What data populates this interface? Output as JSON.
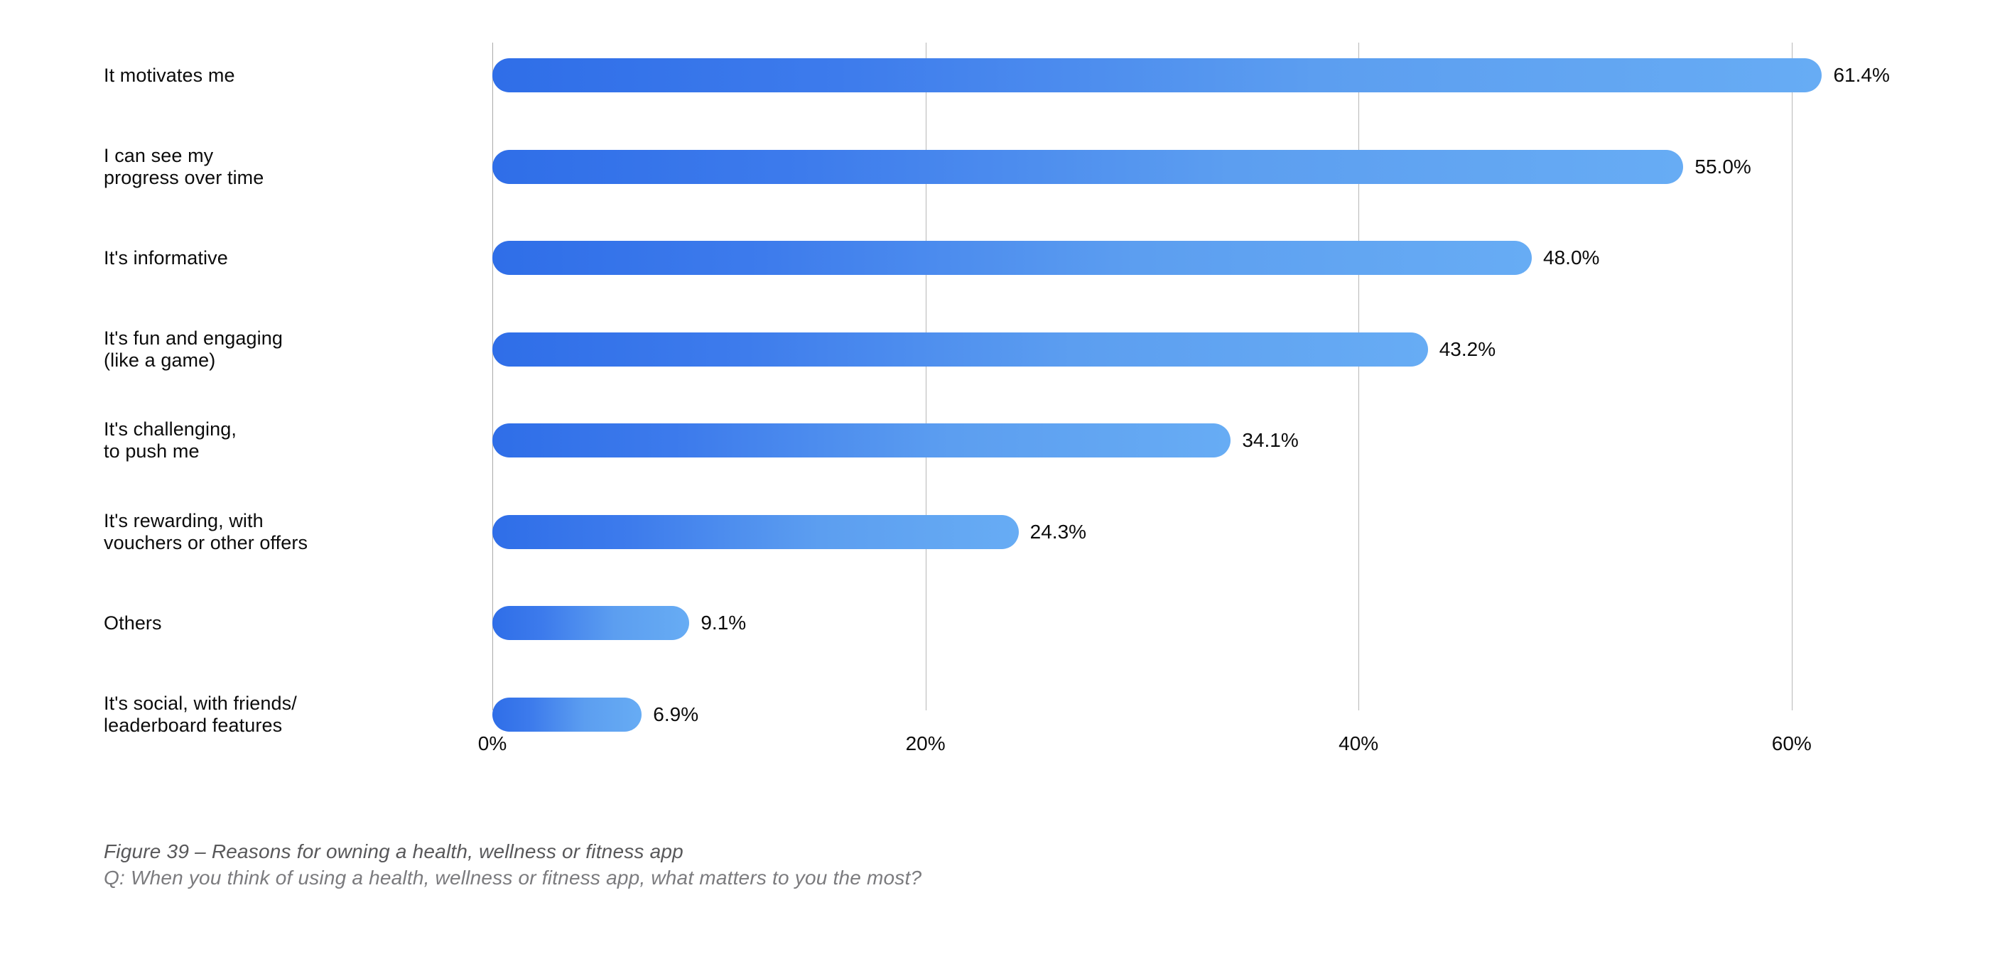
{
  "chart_data": {
    "type": "bar",
    "orientation": "horizontal",
    "title": "Figure 39 – Reasons for owning a health, wellness or fitness app",
    "subtitle": "Q: When you think of using a health, wellness or fitness app, what matters to you the most?",
    "xlabel": "",
    "ylabel": "",
    "xlim": [
      0,
      65.5
    ],
    "xticks": [
      0,
      20,
      40,
      60
    ],
    "xtick_labels": [
      "0%",
      "20%",
      "40%",
      "60%"
    ],
    "grid": "vertical-only",
    "legend": "none",
    "categories": [
      "It motivates me",
      "I can see my\nprogress over time",
      "It's informative",
      "It's fun and engaging\n(like a game)",
      "It's challenging,\nto push me",
      "It's rewarding, with\nvouchers or other offers",
      "Others",
      "It's social, with friends/\nleaderboard features"
    ],
    "values": [
      61.4,
      55.0,
      48.0,
      43.2,
      34.1,
      24.3,
      9.1,
      6.9
    ],
    "value_labels": [
      "61.4%",
      "55.0%",
      "48.0%",
      "43.2%",
      "34.1%",
      "24.3%",
      "9.1%",
      "6.9%"
    ],
    "bar_gradient_start": "#2f6ee8",
    "bar_gradient_end": "#67acf4",
    "gridline_color": "#b8b8b8",
    "label_color": "#0c0c0c",
    "caption_color": "#58585a"
  },
  "caption": {
    "title": "Figure 39 – Reasons for owning a health, wellness or fitness app",
    "question": "Q: When you think of using a health, wellness or fitness app, what matters to you the most?"
  }
}
